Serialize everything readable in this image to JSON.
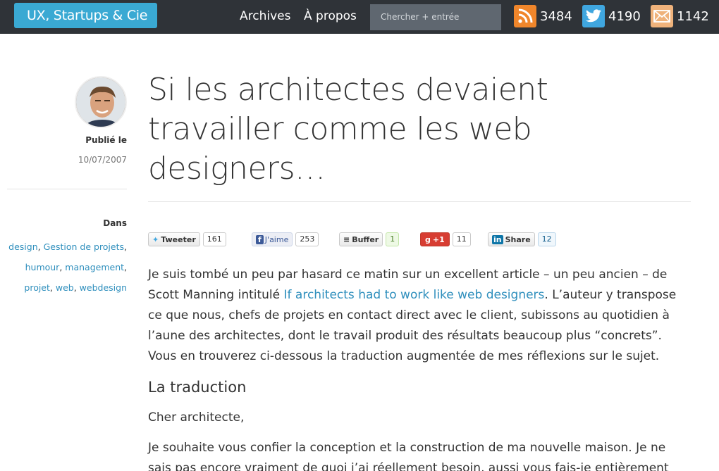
{
  "nav": {
    "brand": "UX, Startups & Cie",
    "links": [
      "Archives",
      "À propos"
    ],
    "search_placeholder": "Chercher + entrée",
    "counters": {
      "rss": {
        "icon": "rss-icon",
        "value": "3484",
        "color": "#f0862b"
      },
      "twitter": {
        "icon": "twitter-icon",
        "value": "4190",
        "color": "#3fa6df"
      },
      "email": {
        "icon": "mail-icon",
        "value": "1142",
        "color": "#efb27b"
      }
    }
  },
  "sidebar": {
    "published_label": "Publié le",
    "published_date": "10/07/2007",
    "in_label": "Dans",
    "tags": [
      "design",
      "Gestion de projets",
      "humour",
      "management",
      "projet",
      "web",
      "webdesign"
    ]
  },
  "article": {
    "title": "Si les architectes devaient travailler comme les web designers…",
    "share": {
      "tweet": {
        "label": "Tweeter",
        "count": "161"
      },
      "facebook": {
        "label": "J'aime",
        "count": "253"
      },
      "buffer": {
        "label": "Buffer",
        "count": "1"
      },
      "gplus": {
        "label": "+1",
        "count": "11"
      },
      "linkedin": {
        "label": "Share",
        "count": "12"
      }
    },
    "intro_before_link": "Je suis tombé un peu par hasard ce matin sur un excellent article – un peu ancien – de Scott Manning intitulé ",
    "intro_link": "If architects had to work like web designers",
    "intro_after_link": ". L’auteur y transpose ce que nous, chefs de projets en contact direct avec le client, subissons au quotidien à l’aune des architectes, dont le travail produit des résultats beaucoup plus “concrets”. Vous en trouverez ci-dessous la traduction augmentée de mes réflexions sur le sujet.",
    "section_heading": "La traduction",
    "salutation": "Cher architecte,",
    "para2": "Je souhaite vous confier la conception et la construction de ma nouvelle maison. Je ne sais pas encore vraiment de quoi j’ai réellement besoin, aussi vous fais-je entièrement"
  },
  "colors": {
    "accent": "#3aa9d3",
    "topbar": "#2f3338",
    "link": "#2f8fbd"
  }
}
